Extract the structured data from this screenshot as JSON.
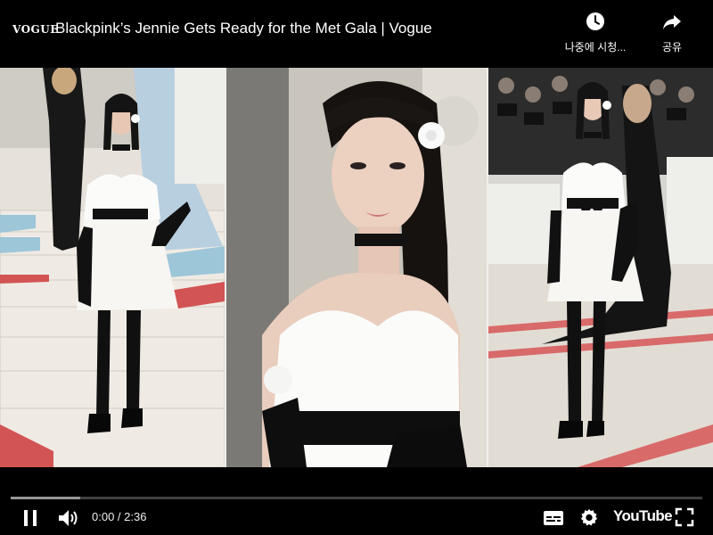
{
  "topbar": {
    "channel_logo": "VOGUE",
    "title": "Blackpink’s Jennie Gets Ready for the Met Gala | Vogue",
    "watch_later_label": "나중에 시청...",
    "share_label": "공유"
  },
  "controls": {
    "current_time": "0:00",
    "duration": "2:36",
    "time_display": "0:00 / 2:36",
    "played_fraction": 0.0,
    "buffered_fraction": 0.1,
    "logo_text": "YouTube",
    "icons": [
      "pause-icon",
      "volume-icon",
      "subtitles-icon",
      "settings-icon",
      "youtube-logo",
      "fullscreen-icon"
    ]
  },
  "colors": {
    "progress_played": "#ff0000",
    "background": "#000000"
  }
}
